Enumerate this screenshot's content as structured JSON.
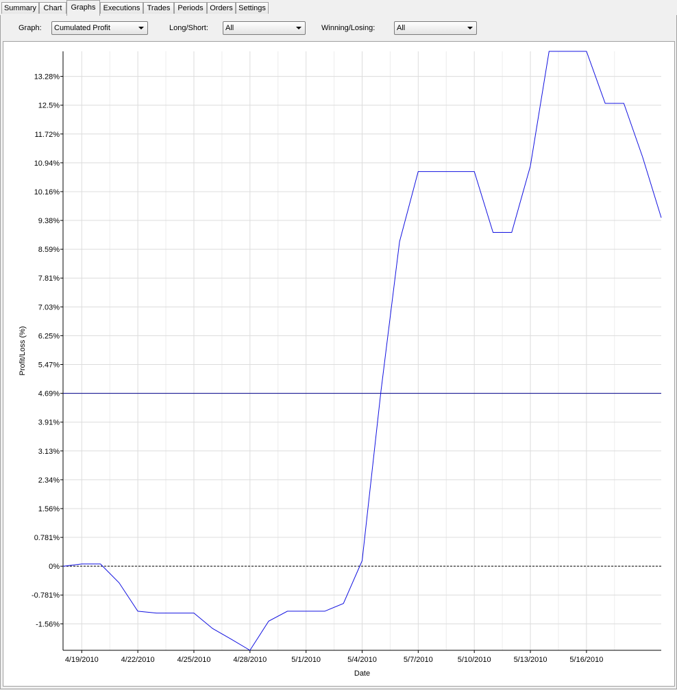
{
  "tabs": [
    {
      "label": "Summary",
      "active": false
    },
    {
      "label": "Chart",
      "active": false
    },
    {
      "label": "Graphs",
      "active": true
    },
    {
      "label": "Executions",
      "active": false
    },
    {
      "label": "Trades",
      "active": false
    },
    {
      "label": "Periods",
      "active": false
    },
    {
      "label": "Orders",
      "active": false
    },
    {
      "label": "Settings",
      "active": false
    }
  ],
  "filters": {
    "graph_label": "Graph:",
    "graph_value": "Cumulated Profit",
    "longshort_label": "Long/Short:",
    "longshort_value": "All",
    "winlose_label": "Winning/Losing:",
    "winlose_value": "All"
  },
  "chart_data": {
    "type": "line",
    "xlabel": "Date",
    "ylabel": "Profit/Loss (%)",
    "x_tick_labels": [
      "4/19/2010",
      "4/22/2010",
      "4/25/2010",
      "4/28/2010",
      "5/1/2010",
      "5/4/2010",
      "5/7/2010",
      "5/10/2010",
      "5/13/2010",
      "5/16/2010"
    ],
    "x_tick_values": [
      1,
      4,
      7,
      10,
      13,
      16,
      19,
      22,
      25,
      28
    ],
    "xlim": [
      0,
      32
    ],
    "y_tick_labels": [
      "-1.56%",
      "-0.781%",
      "0%",
      "0.781%",
      "1.56%",
      "2.34%",
      "3.13%",
      "3.91%",
      "4.69%",
      "5.47%",
      "6.25%",
      "7.03%",
      "7.81%",
      "8.59%",
      "9.38%",
      "10.16%",
      "10.94%",
      "11.72%",
      "12.5%",
      "13.28%"
    ],
    "y_tick_values": [
      -1.5625,
      -0.78125,
      0,
      0.78125,
      1.5625,
      2.34375,
      3.125,
      3.90625,
      4.6875,
      5.46875,
      6.25,
      7.03125,
      7.8125,
      8.59375,
      9.375,
      10.15625,
      10.9375,
      11.71875,
      12.5,
      13.28125
    ],
    "ylim": [
      -2.28,
      13.96
    ],
    "grid": true,
    "series": [
      {
        "color": "#1010e0",
        "x": [
          0,
          1,
          2,
          3,
          4,
          5,
          6,
          7,
          8,
          9,
          10,
          11,
          12,
          13,
          14,
          15,
          16,
          17,
          18,
          19,
          20,
          21,
          22,
          23,
          24,
          25,
          26,
          27,
          28,
          29,
          30,
          31,
          32
        ],
        "y": [
          0.0,
          0.06,
          0.06,
          -0.45,
          -1.22,
          -1.27,
          -1.27,
          -1.27,
          -1.69,
          -1.98,
          -2.28,
          -1.49,
          -1.22,
          -1.22,
          -1.22,
          -1.01,
          0.15,
          4.72,
          8.8,
          10.7,
          10.7,
          10.7,
          10.7,
          9.05,
          9.05,
          10.85,
          13.96,
          13.96,
          13.96,
          12.55,
          12.55,
          11.1,
          9.45
        ]
      }
    ],
    "reference_lines": [
      {
        "y": 4.6875,
        "style": "solid",
        "color": "#00008b"
      },
      {
        "y": 0,
        "style": "dashed",
        "color": "#000000"
      }
    ]
  }
}
